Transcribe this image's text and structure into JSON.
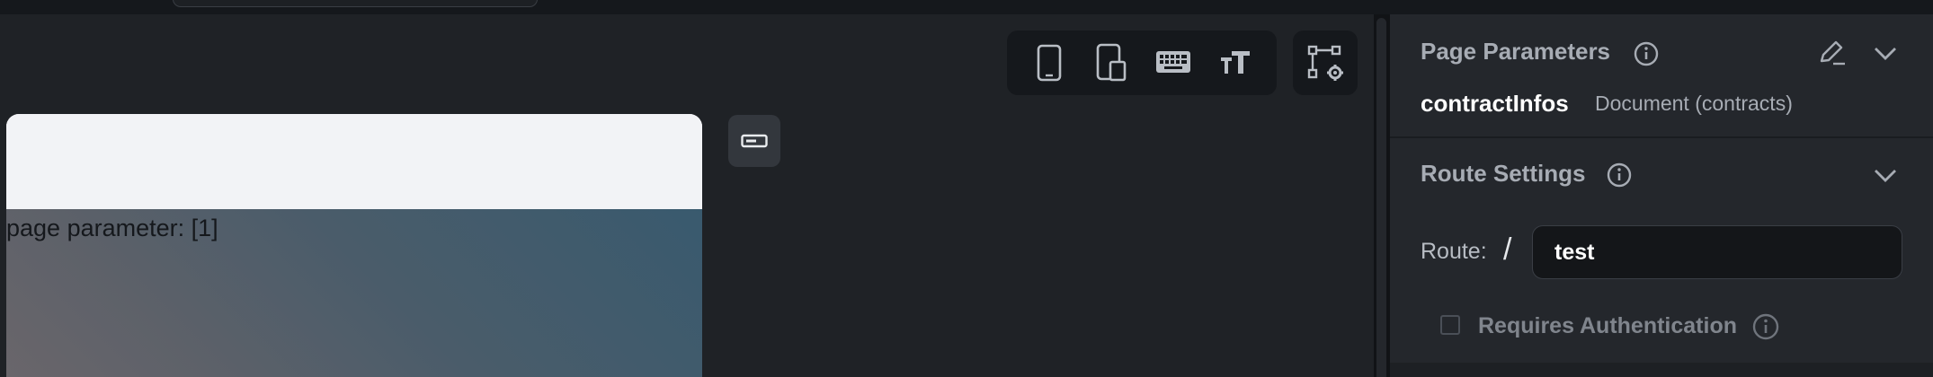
{
  "phone": {
    "body_text": "page parameter: [1]"
  },
  "toolbar": {
    "tools": [
      "phone-icon",
      "tablet-icon",
      "keyboard-icon",
      "text-size-icon"
    ],
    "flow_tool": "flow-settings-icon",
    "widget_button": "widget-bar-icon"
  },
  "panel": {
    "page_parameters": {
      "title": "Page Parameters",
      "param_name": "contractInfos",
      "param_type": "Document (contracts)"
    },
    "route_settings": {
      "title": "Route Settings",
      "route_label": "Route:",
      "route_slash": "/",
      "route_value": "test",
      "requires_auth_label": "Requires Authentication",
      "requires_auth_checked": false
    }
  },
  "colors": {
    "canvas_bg": "#1f2226",
    "panel_bg": "#24272c",
    "toolbar_bg": "#15181c",
    "muted_text": "#a7acb4"
  }
}
